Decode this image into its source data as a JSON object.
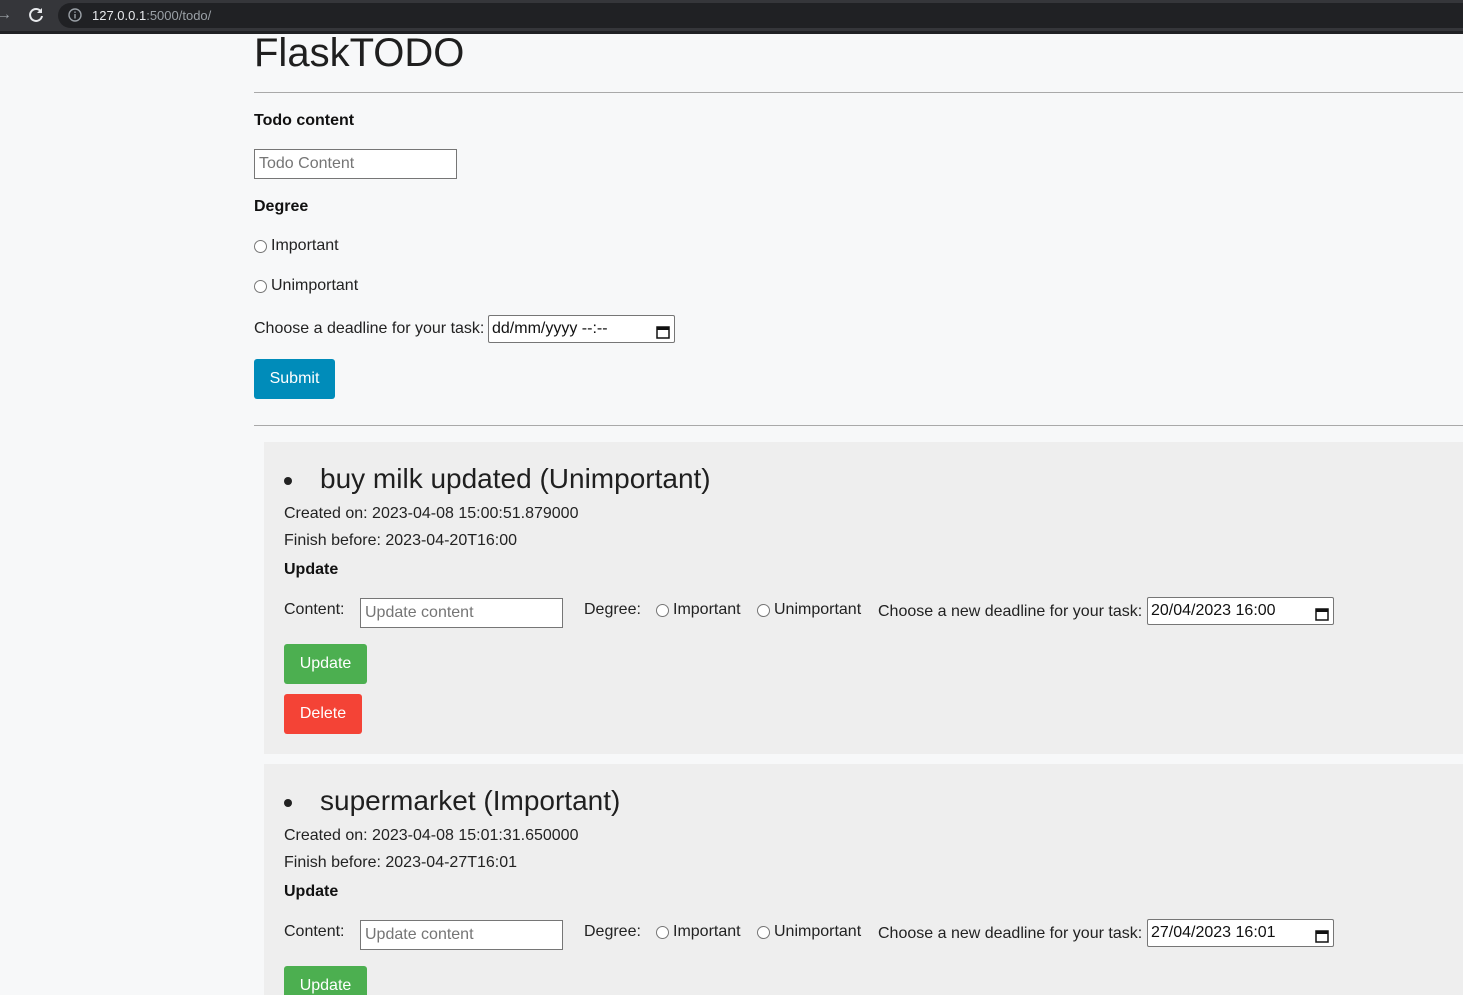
{
  "browser": {
    "url_host": "127.0.0.1",
    "url_path": ":5000/todo/"
  },
  "page": {
    "title": "FlaskTODO"
  },
  "form": {
    "content_label": "Todo content",
    "content_placeholder": "Todo Content",
    "degree_label": "Degree",
    "option_important": "Important",
    "option_unimportant": "Unimportant",
    "deadline_label": "Choose a deadline for your task:",
    "deadline_value": "dd/mm/yyyy --:--",
    "submit_label": "Submit"
  },
  "todos": [
    {
      "title": "buy milk updated (Unimportant)",
      "created": "Created on: 2023-04-08 15:00:51.879000",
      "finish": "Finish before: 2023-04-20T16:00",
      "update_heading": "Update",
      "content_label": "Content:",
      "content_placeholder": "Update content",
      "degree_label": "Degree:",
      "option_important": "Important",
      "option_unimportant": "Unimportant",
      "deadline_label": "Choose a new deadline for your task:",
      "deadline_value": "20/04/2023 16:00",
      "update_button": "Update",
      "delete_button": "Delete"
    },
    {
      "title": "supermarket (Important)",
      "created": "Created on: 2023-04-08 15:01:31.650000",
      "finish": "Finish before: 2023-04-27T16:01",
      "update_heading": "Update",
      "content_label": "Content:",
      "content_placeholder": "Update content",
      "degree_label": "Degree:",
      "option_important": "Important",
      "option_unimportant": "Unimportant",
      "deadline_label": "Choose a new deadline for your task:",
      "deadline_value": "27/04/2023 16:01",
      "update_button": "Update"
    }
  ],
  "colors": {
    "submit": "#008cba",
    "update": "#4caf50",
    "delete": "#f44336",
    "card_bg": "#eeeeee"
  }
}
